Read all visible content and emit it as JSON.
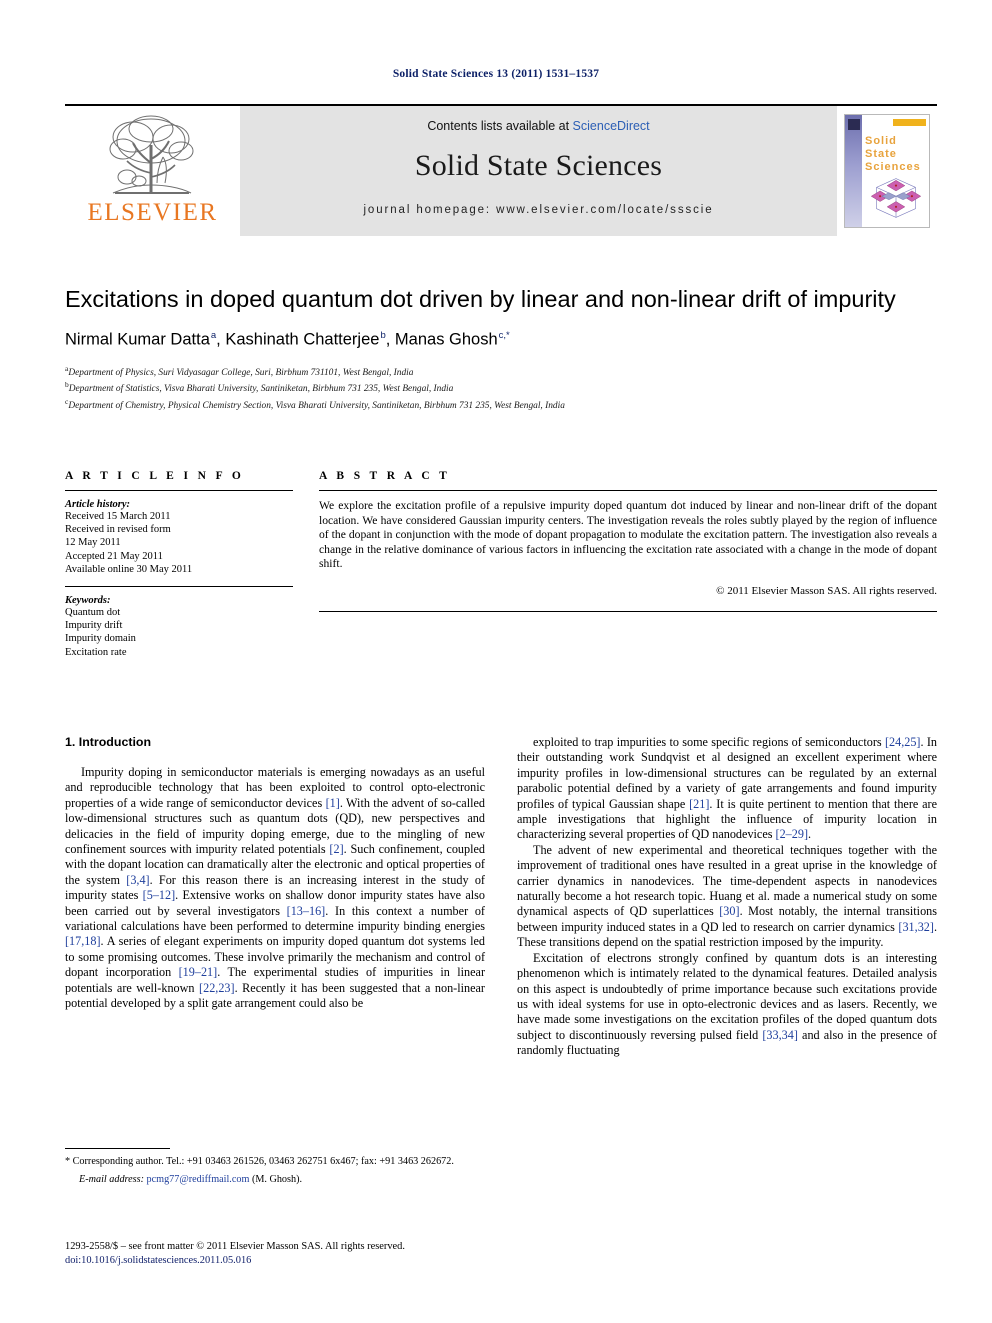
{
  "running_head": "Solid State Sciences 13 (2011) 1531–1537",
  "banner": {
    "publisher_wordmark": "ELSEVIER",
    "contents_prefix": "Contents lists available at ",
    "contents_link": "ScienceDirect",
    "journal_name": "Solid State Sciences",
    "homepage": "journal homepage: www.elsevier.com/locate/ssscie",
    "cover_title_line1": "Solid",
    "cover_title_line2": "State",
    "cover_title_line3": "Sciences",
    "accent_blue": "#2c5fb5",
    "elsevier_orange": "#E87722",
    "banner_gray": "#e3e3e3"
  },
  "article": {
    "title": "Excitations in doped quantum dot driven by linear and non-linear drift of impurity",
    "authors": [
      {
        "name": "Nirmal Kumar Datta",
        "marker": "a"
      },
      {
        "name": "Kashinath Chatterjee",
        "marker": "b"
      },
      {
        "name": "Manas Ghosh",
        "marker": "c,*"
      }
    ],
    "authors_line": "Nirmal Kumar Datta a, Kashinath Chatterjee b, Manas Ghosh c,*",
    "affiliations": [
      {
        "marker": "a",
        "text": "Department of Physics, Suri Vidyasagar College, Suri, Birbhum 731101, West Bengal, India"
      },
      {
        "marker": "b",
        "text": "Department of Statistics, Visva Bharati University, Santiniketan, Birbhum 731 235, West Bengal, India"
      },
      {
        "marker": "c",
        "text": "Department of Chemistry, Physical Chemistry Section, Visva Bharati University, Santiniketan, Birbhum 731 235, West Bengal, India"
      }
    ]
  },
  "article_info": {
    "heading": "A R T I C L E   I N F O",
    "history_label": "Article history:",
    "history": [
      "Received 15 March 2011",
      "Received in revised form",
      "12 May 2011",
      "Accepted 21 May 2011",
      "Available online 30 May 2011"
    ],
    "keywords_label": "Keywords:",
    "keywords": [
      "Quantum dot",
      "Impurity drift",
      "Impurity domain",
      "Excitation rate"
    ]
  },
  "abstract": {
    "heading": "A B S T R A C T",
    "text": "We explore the excitation profile of a repulsive impurity doped quantum dot induced by linear and non-linear drift of the dopant location. We have considered Gaussian impurity centers. The investigation reveals the roles subtly played by the region of influence of the dopant in conjunction with the mode of dopant propagation to modulate the excitation pattern. The investigation also reveals a change in the relative dominance of various factors in influencing the excitation rate associated with a change in the mode of dopant shift.",
    "copyright": "© 2011 Elsevier Masson SAS. All rights reserved."
  },
  "body": {
    "section_heading": "1. Introduction",
    "left_paragraphs": [
      "Impurity doping in semiconductor materials is emerging nowadays as an useful and reproducible technology that has been exploited to control opto-electronic properties of a wide range of semiconductor devices [1]. With the advent of so-called low-dimensional structures such as quantum dots (QD), new perspectives and delicacies in the field of impurity doping emerge, due to the mingling of new confinement sources with impurity related potentials [2]. Such confinement, coupled with the dopant location can dramatically alter the electronic and optical properties of the system [3,4]. For this reason there is an increasing interest in the study of impurity states [5–12]. Extensive works on shallow donor impurity states have also been carried out by several investigators [13–16]. In this context a number of variational calculations have been performed to determine impurity binding energies [17,18]. A series of elegant experiments on impurity doped quantum dot systems led to some promising outcomes. These involve primarily the mechanism and control of dopant incorporation [19–21]. The experimental studies of impurities in linear potentials are well-known [22,23]. Recently it has been suggested that a non-linear potential developed by a split gate arrangement could also be"
    ],
    "right_paragraphs": [
      "exploited to trap impurities to some specific regions of semiconductors [24,25]. In their outstanding work Sundqvist et al designed an excellent experiment where impurity profiles in low-dimensional structures can be regulated by an external parabolic potential defined by a variety of gate arrangements and found impurity profiles of typical Gaussian shape [21]. It is quite pertinent to mention that there are ample investigations that highlight the influence of impurity location in characterizing several properties of QD nanodevices [2–29].",
      "The advent of new experimental and theoretical techniques together with the improvement of traditional ones have resulted in a great uprise in the knowledge of carrier dynamics in nanodevices. The time-dependent aspects in nanodevices naturally become a hot research topic. Huang et al. made a numerical study on some dynamical aspects of QD superlattices [30]. Most notably, the internal transitions between impurity induced states in a QD led to research on carrier dynamics [31,32]. These transitions depend on the spatial restriction imposed by the impurity.",
      "Excitation of electrons strongly confined by quantum dots is an interesting phenomenon which is intimately related to the dynamical features. Detailed analysis on this aspect is undoubtedly of prime importance because such excitations provide us with ideal systems for use in opto-electronic devices and as lasers. Recently, we have made some investigations on the excitation profiles of the doped quantum dots subject to discontinuously reversing pulsed field [33,34] and also in the presence of randomly fluctuating"
    ]
  },
  "footnote": {
    "corresponding": "* Corresponding author. Tel.: +91 03463 261526, 03463 262751 6x467; fax: +91 3463 262672.",
    "email_label": "E-mail address:",
    "email": "pcmg77@rediffmail.com",
    "email_suffix": "(M. Ghosh)."
  },
  "imprint": {
    "front_matter": "1293-2558/$ – see front matter © 2011 Elsevier Masson SAS. All rights reserved.",
    "doi": "doi:10.1016/j.solidstatesciences.2011.05.016"
  }
}
